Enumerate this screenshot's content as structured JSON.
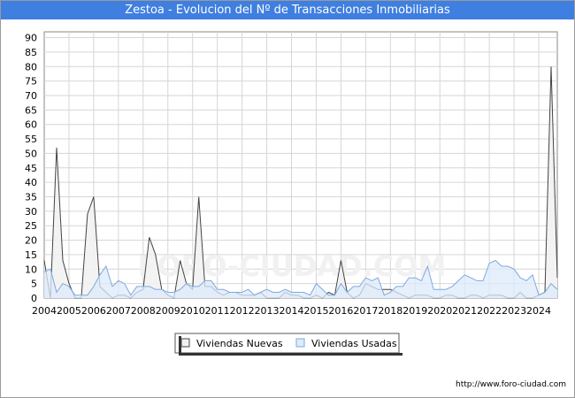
{
  "chart_data": {
    "type": "area",
    "title": "Zestoa - Evolucion del Nº de Transacciones Inmobiliarias",
    "xlabel": "",
    "ylabel": "",
    "ylim": [
      0,
      92
    ],
    "yticks": [
      0,
      5,
      10,
      15,
      20,
      25,
      30,
      35,
      40,
      45,
      50,
      55,
      60,
      65,
      70,
      75,
      80,
      85,
      90
    ],
    "xlim": [
      2004,
      2024.75
    ],
    "xticks": [
      2004,
      2005,
      2006,
      2007,
      2008,
      2009,
      2010,
      2011,
      2012,
      2013,
      2014,
      2015,
      2016,
      2017,
      2018,
      2019,
      2020,
      2021,
      2022,
      2023,
      2024
    ],
    "grid": true,
    "legend_position": "bottom",
    "colors": {
      "nuevas_fill": "#f2f2f2",
      "nuevas_line": "#444444",
      "usadas_fill": "#dcebfb",
      "usadas_line": "#7ea9df",
      "title_bg": "#3f7fe0"
    },
    "series": [
      {
        "name": "Viviendas Nuevas",
        "x": [
          2004.0,
          2004.25,
          2004.5,
          2004.75,
          2005.0,
          2005.25,
          2005.5,
          2005.75,
          2006.0,
          2006.25,
          2006.5,
          2006.75,
          2007.0,
          2007.25,
          2007.5,
          2007.75,
          2008.0,
          2008.25,
          2008.5,
          2008.75,
          2009.0,
          2009.25,
          2009.5,
          2009.75,
          2010.0,
          2010.25,
          2010.5,
          2010.75,
          2011.0,
          2011.25,
          2011.5,
          2011.75,
          2012.0,
          2012.25,
          2012.5,
          2012.75,
          2013.0,
          2013.25,
          2013.5,
          2013.75,
          2014.0,
          2014.25,
          2014.5,
          2014.75,
          2015.0,
          2015.25,
          2015.5,
          2015.75,
          2016.0,
          2016.25,
          2016.5,
          2016.75,
          2017.0,
          2017.25,
          2017.5,
          2017.75,
          2018.0,
          2018.25,
          2018.5,
          2018.75,
          2019.0,
          2019.25,
          2019.5,
          2019.75,
          2020.0,
          2020.25,
          2020.5,
          2020.75,
          2021.0,
          2021.25,
          2021.5,
          2021.75,
          2022.0,
          2022.25,
          2022.5,
          2022.75,
          2023.0,
          2023.25,
          2023.5,
          2023.75,
          2024.0,
          2024.25,
          2024.5,
          2024.75
        ],
        "values": [
          13,
          0,
          52,
          13,
          5,
          0,
          0,
          29,
          35,
          4,
          2,
          0,
          1,
          1,
          0,
          2,
          3,
          21,
          15,
          3,
          1,
          0,
          13,
          5,
          3,
          35,
          4,
          4,
          2,
          1,
          2,
          2,
          1,
          1,
          1,
          2,
          0,
          0,
          0,
          2,
          1,
          1,
          0,
          0,
          1,
          0,
          2,
          1,
          13,
          2,
          0,
          1,
          5,
          4,
          3,
          3,
          3,
          2,
          1,
          0,
          1,
          1,
          1,
          0,
          0,
          1,
          1,
          0,
          0,
          1,
          1,
          0,
          1,
          1,
          1,
          0,
          0,
          2,
          0,
          0,
          1,
          2,
          80,
          7
        ]
      },
      {
        "name": "Viviendas Usadas",
        "x": [
          2004.0,
          2004.25,
          2004.5,
          2004.75,
          2005.0,
          2005.25,
          2005.5,
          2005.75,
          2006.0,
          2006.25,
          2006.5,
          2006.75,
          2007.0,
          2007.25,
          2007.5,
          2007.75,
          2008.0,
          2008.25,
          2008.5,
          2008.75,
          2009.0,
          2009.25,
          2009.5,
          2009.75,
          2010.0,
          2010.25,
          2010.5,
          2010.75,
          2011.0,
          2011.25,
          2011.5,
          2011.75,
          2012.0,
          2012.25,
          2012.5,
          2012.75,
          2013.0,
          2013.25,
          2013.5,
          2013.75,
          2014.0,
          2014.25,
          2014.5,
          2014.75,
          2015.0,
          2015.25,
          2015.5,
          2015.75,
          2016.0,
          2016.25,
          2016.5,
          2016.75,
          2017.0,
          2017.25,
          2017.5,
          2017.75,
          2018.0,
          2018.25,
          2018.5,
          2018.75,
          2019.0,
          2019.25,
          2019.5,
          2019.75,
          2020.0,
          2020.25,
          2020.5,
          2020.75,
          2021.0,
          2021.25,
          2021.5,
          2021.75,
          2022.0,
          2022.25,
          2022.5,
          2022.75,
          2023.0,
          2023.25,
          2023.5,
          2023.75,
          2024.0,
          2024.25,
          2024.5,
          2024.75
        ],
        "values": [
          9,
          10,
          2,
          5,
          4,
          1,
          1,
          1,
          4,
          8,
          11,
          4,
          6,
          5,
          1,
          4,
          4,
          4,
          3,
          3,
          2,
          2,
          3,
          5,
          4,
          4,
          6,
          6,
          3,
          3,
          2,
          2,
          2,
          3,
          1,
          2,
          3,
          2,
          2,
          3,
          2,
          2,
          2,
          1,
          5,
          3,
          1,
          1,
          5,
          2,
          4,
          4,
          7,
          6,
          7,
          1,
          2,
          4,
          4,
          7,
          7,
          6,
          11,
          3,
          3,
          3,
          4,
          6,
          8,
          7,
          6,
          6,
          12,
          13,
          11,
          11,
          10,
          7,
          6,
          8,
          1,
          2,
          5,
          3
        ]
      }
    ],
    "legend": [
      "Viviendas Nuevas",
      "Viviendas Usadas"
    ],
    "watermark": "FORO-CIUDAD.COM",
    "source_url": "http://www.foro-ciudad.com"
  }
}
